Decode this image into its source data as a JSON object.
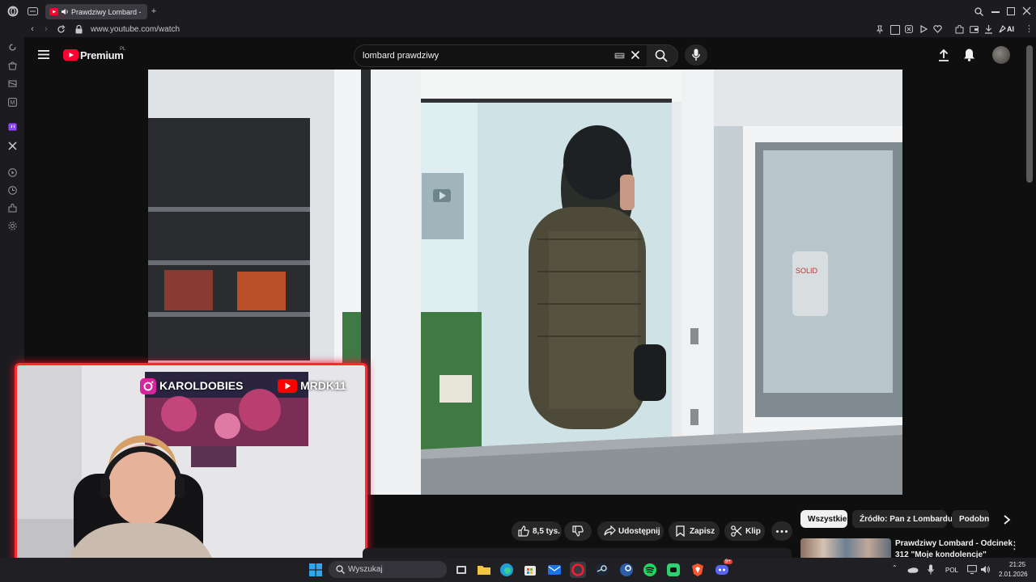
{
  "browser": {
    "tab_title": "Prawdziwy Lombard -",
    "url": "www.youtube.com/watch",
    "ai_label": "AI"
  },
  "youtube": {
    "logo_text": "Premium",
    "logo_region": "PL",
    "search_query": "lombard prawdziwy"
  },
  "video": {
    "sign_text": "SOLID"
  },
  "webcam": {
    "instagram_handle": "KAROLDOBIES",
    "youtube_handle": "MRDK11"
  },
  "actions": {
    "likes": "8,5 tys.",
    "share": "Udostępnij",
    "save": "Zapisz",
    "clip": "Klip"
  },
  "chips": [
    "Wszystkie",
    "Źródło: Pan z Lombardu",
    "Podobne"
  ],
  "recommended": {
    "title_line1": "Prawdziwy Lombard - Odcinek",
    "title_line2": "312 \"Moje kondolencje\""
  },
  "taskbar": {
    "search_placeholder": "Wyszukaj",
    "language": "POL",
    "time": "21:25",
    "date": "2.01.2026",
    "discord_badge": "9+"
  },
  "colors": {
    "youtube_red": "#ff0033",
    "webcam_border": "#ff2a2a",
    "background": "#0f0f0f"
  }
}
